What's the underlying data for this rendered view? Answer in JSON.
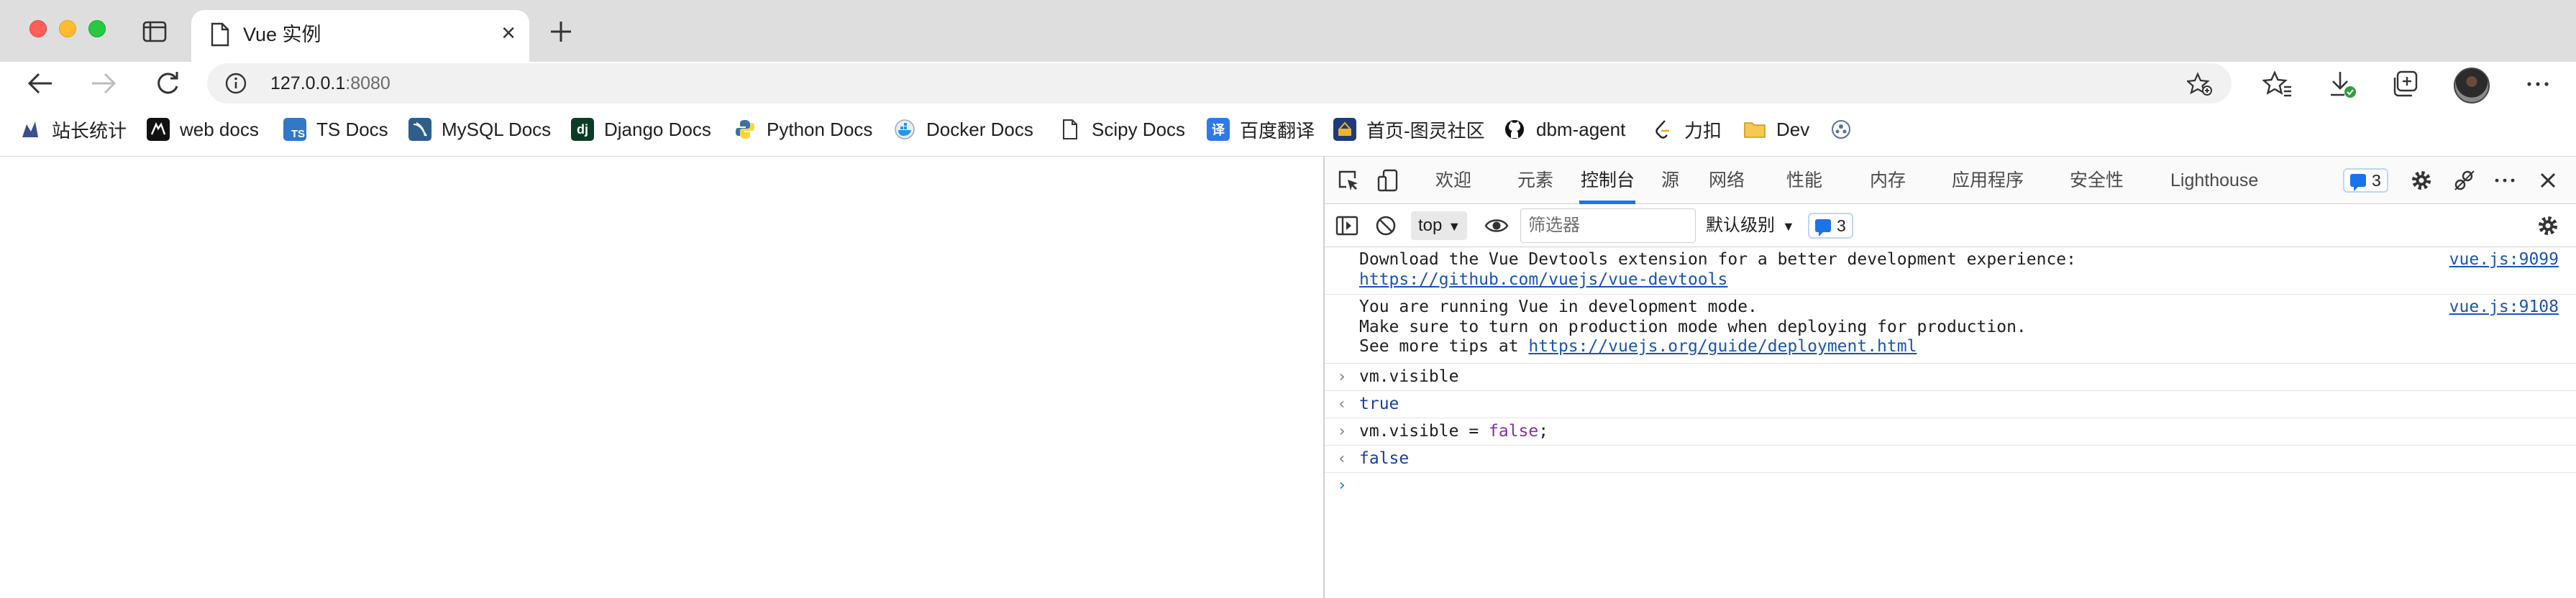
{
  "window": {
    "tab_title": "Vue 实例"
  },
  "toolbar": {
    "url_host": "127.0.0.1",
    "url_port": ":8080"
  },
  "bookmarks": [
    {
      "label": "站长统计",
      "icon": "chart-bird-icon"
    },
    {
      "label": "web docs",
      "icon": "mdn-icon"
    },
    {
      "label": "TS Docs",
      "icon": "typescript-icon"
    },
    {
      "label": "MySQL Docs",
      "icon": "mysql-icon"
    },
    {
      "label": "Django Docs",
      "icon": "django-icon"
    },
    {
      "label": "Python Docs",
      "icon": "python-icon"
    },
    {
      "label": "Docker Docs",
      "icon": "docker-icon"
    },
    {
      "label": "Scipy Docs",
      "icon": "page-icon"
    },
    {
      "label": "百度翻译",
      "icon": "translate-icon"
    },
    {
      "label": "首页-图灵社区",
      "icon": "turing-icon"
    },
    {
      "label": "dbm-agent",
      "icon": "github-icon"
    },
    {
      "label": "力扣",
      "icon": "leetcode-icon"
    },
    {
      "label": "Dev",
      "icon": "folder-icon"
    }
  ],
  "devtools": {
    "tabs": [
      "欢迎",
      "元素",
      "控制台",
      "源",
      "网络",
      "性能",
      "内存",
      "应用程序",
      "安全性",
      "Lighthouse"
    ],
    "active_tab": "控制台",
    "issues_count": "3",
    "context": "top",
    "filter_placeholder": "筛选器",
    "level": "默认级别",
    "console_issues_count": "3",
    "messages": [
      {
        "line1": "Download the Vue Devtools extension for a better development experience:",
        "link": "https://github.com/vuejs/vue-devtools",
        "source": "vue.js:9099"
      },
      {
        "line1": "You are running Vue in development mode.",
        "line2": "Make sure to turn on production mode when deploying for production.",
        "line3_prefix": "See more tips at ",
        "link": "https://vuejs.org/guide/deployment.html",
        "source": "vue.js:9108"
      }
    ],
    "inputs": [
      {
        "command": "vm.visible",
        "result": "true"
      },
      {
        "command_prefix": "vm.visible = ",
        "command_value": "false",
        "command_suffix": ";",
        "result": "false"
      }
    ]
  },
  "colors": {
    "accent": "#1a73e8",
    "link": "#1a55b0",
    "keyword": "#8a2db0"
  }
}
